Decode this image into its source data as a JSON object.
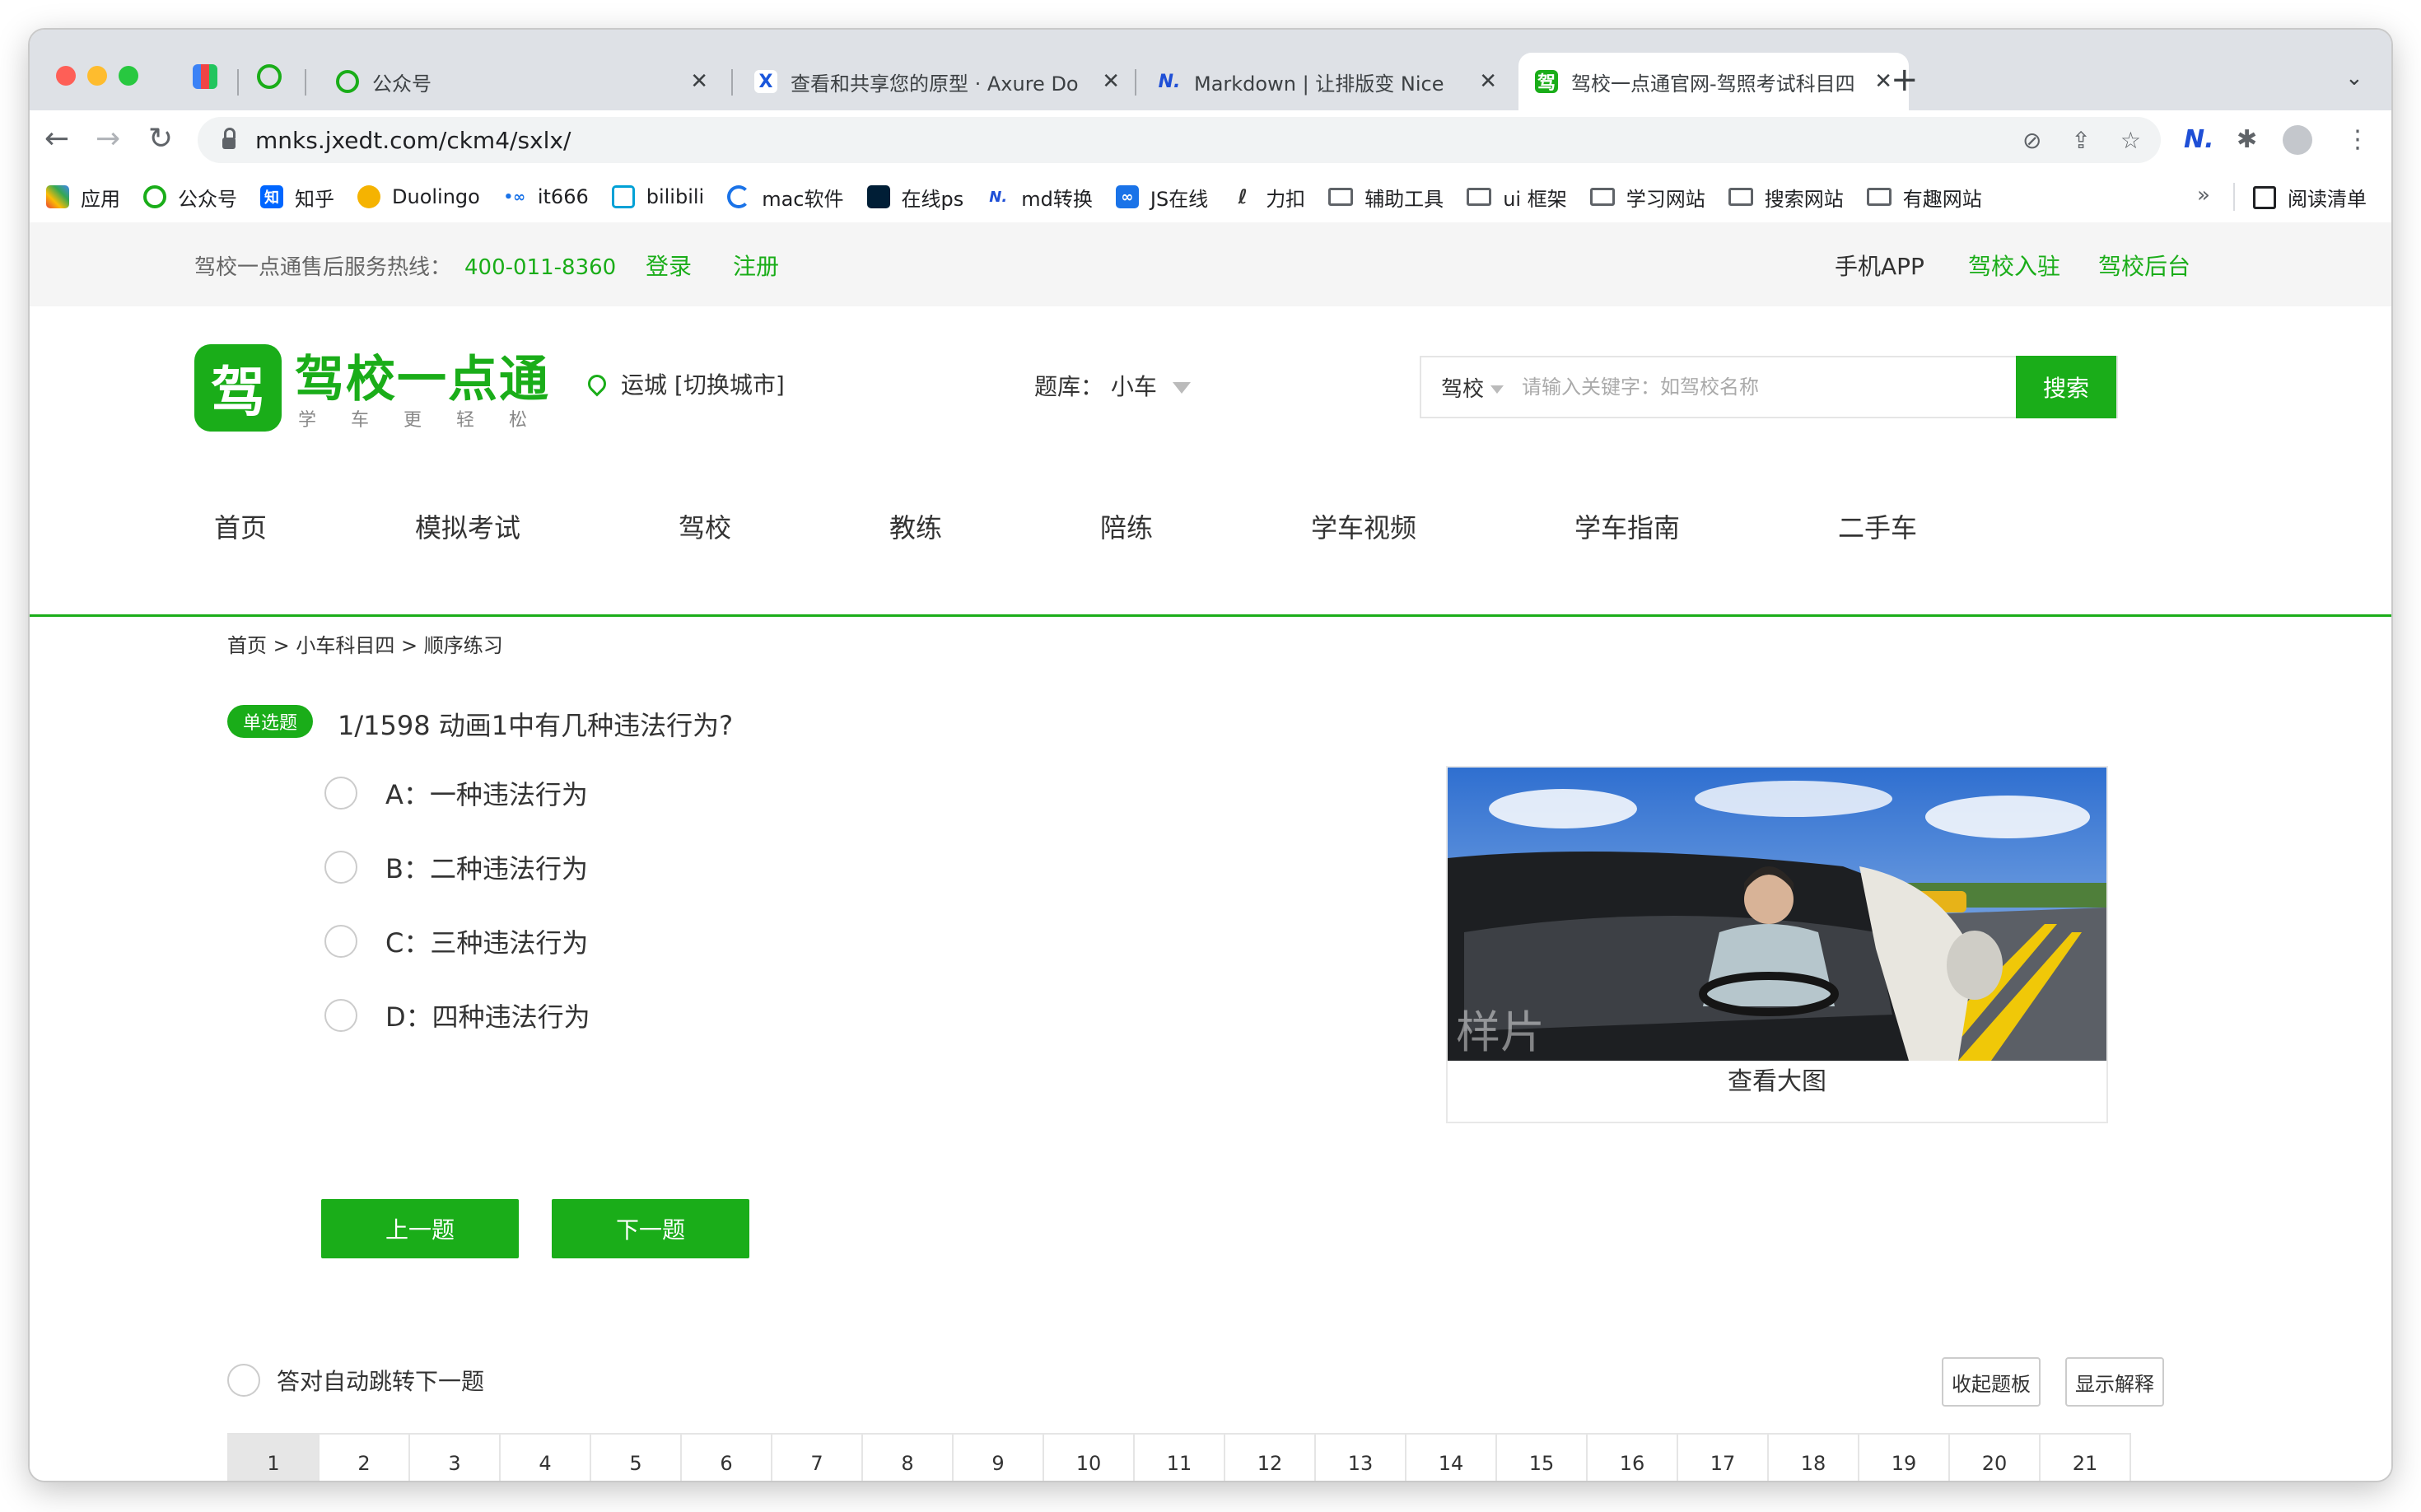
{
  "browser": {
    "pinned_tab_label": "公众号",
    "tabs": [
      {
        "title": "查看和共享您的原型 · Axure Do",
        "fav_color": "#ffffff",
        "fav_text": "X",
        "fav_text_color": "#1a56db"
      },
      {
        "title": "Markdown | 让排版变 Nice",
        "fav_color": "#ffffff",
        "fav_text": "N.",
        "fav_text_color": "#1f4fd6"
      },
      {
        "title": "驾校一点通官网-驾照考试科目四",
        "fav_color": "#1aad19",
        "fav_text": "驾",
        "fav_text_color": "#ffffff"
      }
    ],
    "close_glyph": "✕",
    "new_tab_glyph": "+",
    "url": "mnks.jxedt.com/ckm4/sxlx/"
  },
  "bookmarks": {
    "items": [
      {
        "label": "应用",
        "icon": "apps-grid-icon"
      },
      {
        "label": "公众号",
        "icon": "wechat-icon"
      },
      {
        "label": "知乎",
        "icon": "zhihu-icon"
      },
      {
        "label": "Duolingo",
        "icon": "duolingo-icon"
      },
      {
        "label": "it666",
        "icon": "it666-icon"
      },
      {
        "label": "bilibili",
        "icon": "bilibili-icon"
      },
      {
        "label": "mac软件",
        "icon": "mac-software-icon"
      },
      {
        "label": "在线ps",
        "icon": "photoshop-icon"
      },
      {
        "label": "md转换",
        "icon": "nice-icon"
      },
      {
        "label": "JS在线",
        "icon": "js-icon"
      },
      {
        "label": "力扣",
        "icon": "leetcode-icon"
      },
      {
        "label": "辅助工具",
        "icon": "folder-icon"
      },
      {
        "label": "ui 框架",
        "icon": "folder-icon"
      },
      {
        "label": "学习网站",
        "icon": "folder-icon"
      },
      {
        "label": "搜索网站",
        "icon": "folder-icon"
      },
      {
        "label": "有趣网站",
        "icon": "folder-icon"
      }
    ],
    "more": "»",
    "reading_list": "阅读清单"
  },
  "topbar": {
    "hotline_label": "驾校一点通售后服务热线：",
    "hotline_number": "400-011-8360",
    "login": "登录",
    "register": "注册",
    "app": "手机APP",
    "join": "驾校入驻",
    "backend": "驾校后台"
  },
  "header": {
    "logo_mark": "驾",
    "logo_title": "驾校一点通",
    "logo_slogan": "学车更轻松",
    "city": "运城 [切换城市]",
    "bank_label": "题库：",
    "bank_value": "小车",
    "search_type": "驾校",
    "search_placeholder": "请输入关键字：如驾校名称",
    "search_button": "搜索"
  },
  "nav": [
    "首页",
    "模拟考试",
    "驾校",
    "教练",
    "陪练",
    "学车视频",
    "学车指南",
    "二手车"
  ],
  "breadcrumb": "首页 > 小车科目四 > 顺序练习",
  "question": {
    "type_tag": "单选题",
    "title": "1/1598 动画1中有几种违法行为?",
    "options": [
      "A：一种违法行为",
      "B：二种违法行为",
      "C：三种违法行为",
      "D：四种违法行为"
    ],
    "image_caption": "查看大图",
    "watermark": "样片"
  },
  "buttons": {
    "prev": "上一题",
    "next": "下一题",
    "auto_jump": "答对自动跳转下一题",
    "collapse": "收起题板",
    "explain": "显示解释"
  },
  "grid": {
    "numbers": [
      "1",
      "2",
      "3",
      "4",
      "5",
      "6",
      "7",
      "8",
      "9",
      "10",
      "11",
      "12",
      "13",
      "14",
      "15",
      "16",
      "17",
      "18",
      "19",
      "20",
      "21"
    ],
    "current": "1"
  },
  "colors": {
    "brand_green": "#1aad19"
  }
}
